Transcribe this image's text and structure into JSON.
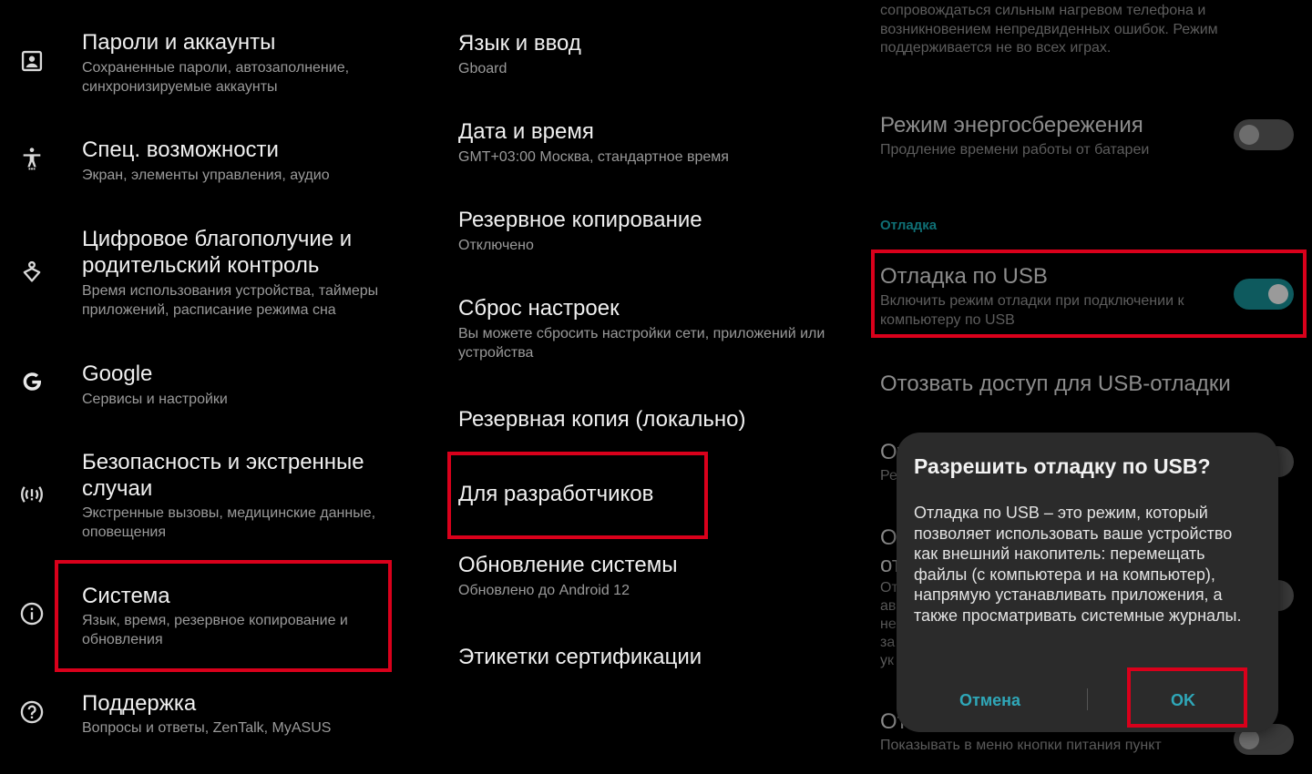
{
  "left_panel": {
    "items": [
      {
        "icon": "account-box-icon",
        "title": "Пароли и аккаунты",
        "subtitle": "Сохраненные пароли, автозаполнение, синхронизируемые аккаунты"
      },
      {
        "icon": "accessibility-icon",
        "title": "Спец. возможности",
        "subtitle": "Экран, элементы управления, аудио"
      },
      {
        "icon": "wellbeing-icon",
        "title": "Цифровое благополучие и родительский контроль",
        "subtitle": "Время использования устройства, таймеры приложений, расписание режима сна"
      },
      {
        "icon": "google-icon",
        "title": "Google",
        "subtitle": "Сервисы и настройки"
      },
      {
        "icon": "emergency-icon",
        "title": "Безопасность и экстренные случаи",
        "subtitle": "Экстренные вызовы, медицинские данные, оповещения"
      },
      {
        "icon": "info-icon",
        "title": "Система",
        "subtitle": "Язык, время, резервное копирование и обновления"
      },
      {
        "icon": "help-icon",
        "title": "Поддержка",
        "subtitle": "Вопросы и ответы, ZenTalk, MyASUS"
      }
    ]
  },
  "middle_panel": {
    "items": [
      {
        "title": "Язык и ввод",
        "subtitle": "Gboard"
      },
      {
        "title": "Дата и время",
        "subtitle": "GMT+03:00 Москва, стандартное время"
      },
      {
        "title": "Резервное копирование",
        "subtitle": "Отключено"
      },
      {
        "title": "Сброс настроек",
        "subtitle": "Вы можете сбросить настройки сети, приложений или устройства"
      },
      {
        "title": "Резервная копия (локально)",
        "subtitle": ""
      },
      {
        "title": "Для разработчиков",
        "subtitle": ""
      },
      {
        "title": "Обновление системы",
        "subtitle": "Обновлено до Android 12"
      },
      {
        "title": "Этикетки сертификации",
        "subtitle": ""
      }
    ]
  },
  "right_panel": {
    "top_fragment": "сопровождаться сильным нагревом телефона и возникновением непредвиденных ошибок. Режим поддерживается не во всех играх.",
    "power_saving": {
      "title": "Режим энергосбережения",
      "subtitle": "Продление времени работы от батареи",
      "toggle": "off"
    },
    "section": "Отладка",
    "usb_debugging": {
      "title": "Отладка по USB",
      "subtitle": "Включить режим отладки при подключении к компьютеру по USB",
      "toggle": "on"
    },
    "revoke": {
      "title": "Отозвать доступ для USB-отладки"
    },
    "peek": {
      "a": "От",
      "a_sub": "Ре",
      "b1": "От",
      "b2": "от",
      "c": [
        "От",
        "ав",
        "не",
        "за",
        "ук"
      ],
      "d": "От",
      "d_sub": "Показывать в меню кнопки питания пункт"
    }
  },
  "dialog": {
    "title": "Разрешить отладку по USB?",
    "body": "Отладка по USB – это режим, который позволяет использовать ваше устройство как внешний накопитель: перемещать файлы (с компьютера и на компьютер), напрямую устанавливать приложения, а также просматривать системные журналы.",
    "cancel": "Отмена",
    "ok": "OK"
  },
  "colors": {
    "highlight": "#d9001b",
    "accent": "#2fa7b8"
  }
}
